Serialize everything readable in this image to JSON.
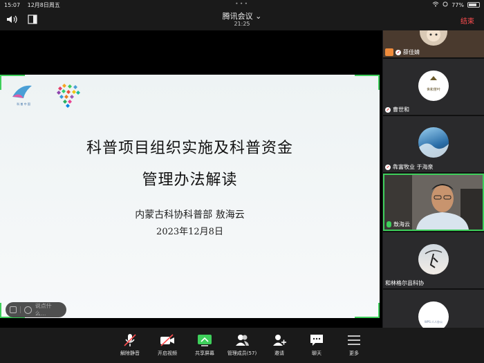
{
  "status": {
    "time": "15:07",
    "date": "12月8日周五",
    "battery": "77%",
    "battery_level": 0.77
  },
  "header": {
    "title": "腾讯会议 ⌄",
    "elapsed": "21:25",
    "end_label": "结束"
  },
  "slide": {
    "logo_text": "科 普 中 国",
    "title_line1": "科普项目组织实施及科普资金",
    "title_line2": "管理办法解读",
    "author": "内蒙古科协科普部  敖海云",
    "date": "2023年12月8日"
  },
  "chat": {
    "placeholder": "说点什么..."
  },
  "participants": [
    {
      "name": "薛佳婧"
    },
    {
      "name": "曹世和",
      "avatar_text": "世和茶叶"
    },
    {
      "name": "犇富牧业 于海泉"
    },
    {
      "name": "敖海云"
    },
    {
      "name": "和林格尔县科协"
    },
    {
      "name": "",
      "avatar_text": "WPS·人人办公"
    }
  ],
  "toolbar": {
    "unmute": "解除静音",
    "video": "开启视频",
    "share": "共享屏幕",
    "members": "管理成员(57)",
    "invite": "邀请",
    "chat": "聊天",
    "more": "更多"
  },
  "colors": {
    "accent_green": "#3ecf5b",
    "end_red": "#ff4d4f"
  }
}
